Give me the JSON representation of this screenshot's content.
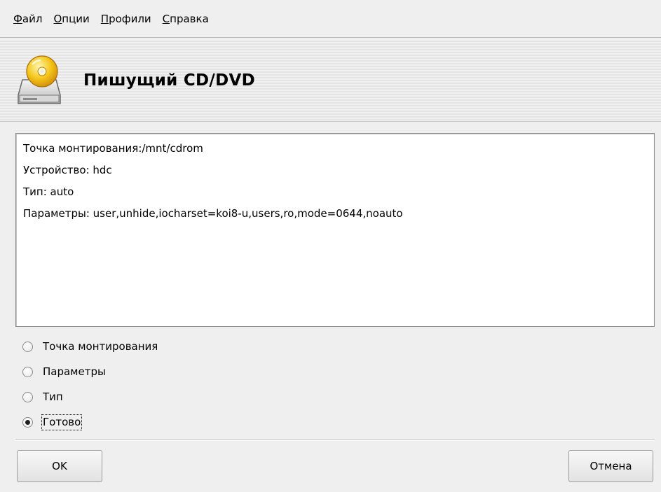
{
  "menu": [
    {
      "accel": "Ф",
      "rest": "айл"
    },
    {
      "accel": "О",
      "rest": "пции"
    },
    {
      "accel": "П",
      "rest": "рофили"
    },
    {
      "accel": "С",
      "rest": "правка"
    }
  ],
  "header": {
    "title": "Пишущий CD/DVD",
    "icon": "cd-drive-icon"
  },
  "info": {
    "mount_point": "Точка монтирования:/mnt/cdrom",
    "device": "Устройство: hdc",
    "type": "Тип: auto",
    "options": "Параметры: user,unhide,iocharset=koi8-u,users,ro,mode=0644,noauto"
  },
  "radios": [
    {
      "label": "Точка монтирования",
      "checked": false
    },
    {
      "label": "Параметры",
      "checked": false
    },
    {
      "label": "Тип",
      "checked": false
    },
    {
      "label": "Готово",
      "checked": true
    }
  ],
  "buttons": {
    "ok": "OK",
    "cancel": "Отмена"
  }
}
